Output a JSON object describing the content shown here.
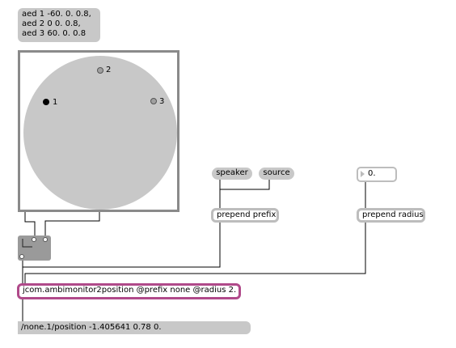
{
  "aed_message": "aed 1 -60. 0. 0.8,\naed 2 0 0. 0.8,\naed 3 60. 0. 0.8",
  "monitor": {
    "speakers": [
      {
        "label": "1",
        "fill": "#000000"
      },
      {
        "label": "2",
        "fill": "#a0a0a0"
      },
      {
        "label": "3",
        "fill": "#a0a0a0"
      }
    ]
  },
  "speaker_message": "speaker",
  "source_message": "source",
  "prepend_prefix": "prepend prefix",
  "number_box_value": "0.",
  "prepend_radius": "prepend radius",
  "ambimonitor_object": "jcom.ambimonitor2position @prefix none @radius 2.",
  "output_message": "/none.1/position -1.405641 0.78 0.",
  "colors": {
    "patch_cord": "#000000",
    "ambimonitor_border": "#b04a8a",
    "object_border": "#bdbdbd"
  }
}
